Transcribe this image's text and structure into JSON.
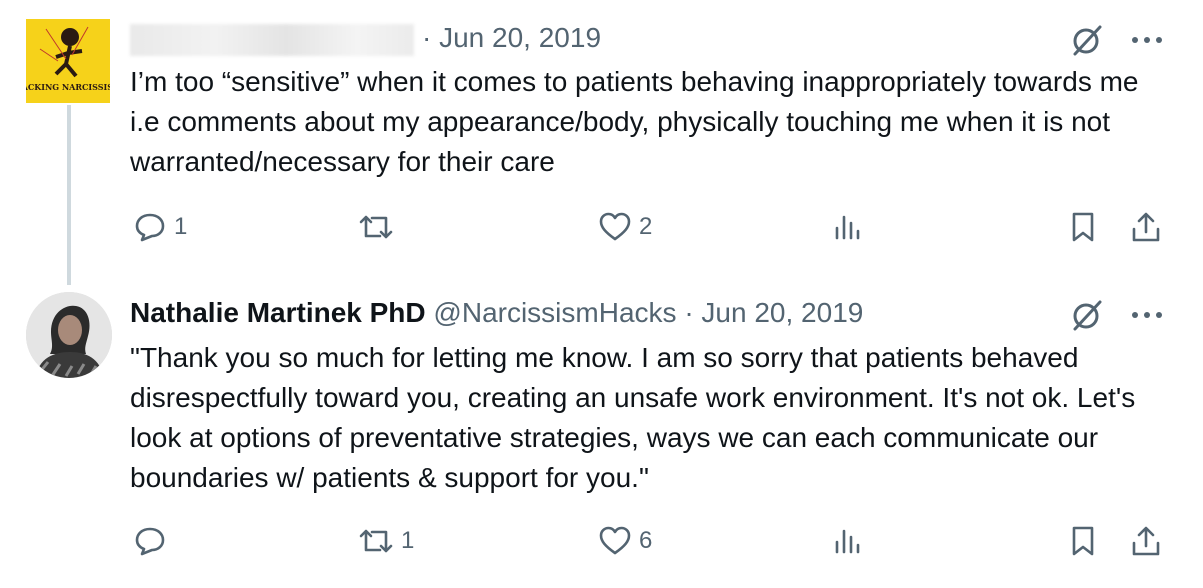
{
  "tweets": [
    {
      "header": {
        "separator": "·",
        "date": "Jun 20, 2019"
      },
      "text": "I’m too “sensitive” when it comes to patients behaving inappropriately towards me i.e comments about my appearance/body, physically touching me when it is not warranted/necessary for their care",
      "avatar": {
        "logo_text": "HACKING NARCISSISM",
        "icon": "hacking-narcissism-logo"
      },
      "metrics": {
        "replies": "1",
        "retweets": "",
        "likes": "2"
      }
    },
    {
      "header": {
        "name": "Nathalie Martinek PhD",
        "handle": "@NarcissismHacks",
        "separator": "·",
        "date": "Jun 20, 2019"
      },
      "text": "\"Thank you so much for letting me know. I am so sorry that patients behaved disrespectfully toward you, creating an unsafe work environment. It's not ok. Let's look at options of preventative strategies, ways we can each communicate our boundaries w/ patients & support for you.\"",
      "avatar": {
        "icon": "profile-photo"
      },
      "metrics": {
        "replies": "",
        "retweets": "1",
        "likes": "6"
      }
    }
  ],
  "colors": {
    "text": "#0f1419",
    "secondary": "#536471",
    "thread_line": "#cfd9de",
    "logo_bg": "#f6d21a"
  }
}
